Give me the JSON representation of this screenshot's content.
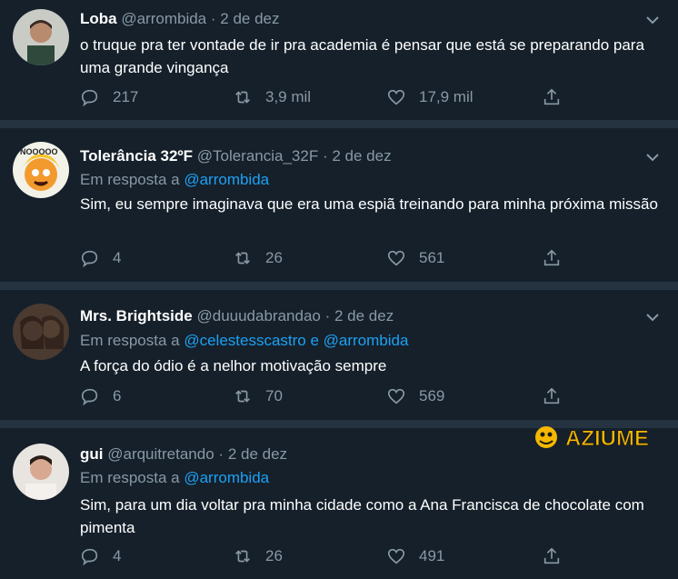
{
  "tweets": [
    {
      "name": "Loba",
      "handle": "@arrombida",
      "sep": "·",
      "date": "2 de dez",
      "reply_prefix": "",
      "reply_to": "",
      "text": "o truque pra ter vontade de ir pra academia é pensar que está se preparando para uma grande vingança",
      "replies": "217",
      "retweets": "3,9 mil",
      "likes": "17,9 mil"
    },
    {
      "name": "Tolerância 32ºF",
      "handle": "@Tolerancia_32F",
      "sep": "·",
      "date": "2 de dez",
      "reply_prefix": "Em resposta a ",
      "reply_to": "@arrombida",
      "text": "Sim, eu sempre imaginava que era uma espiã treinando para minha próxima missão",
      "replies": "4",
      "retweets": "26",
      "likes": "561"
    },
    {
      "name": "Mrs. Brightside",
      "handle": "@duuudabrandao",
      "sep": "·",
      "date": "2 de dez",
      "reply_prefix": "Em resposta a ",
      "reply_to": "@celestesscastro e @arrombida",
      "text": "A força do ódio é a nelhor motivação sempre",
      "replies": "6",
      "retweets": "70",
      "likes": "569"
    },
    {
      "name": "gui",
      "handle": "@arquitretando",
      "sep": "·",
      "date": "2 de dez",
      "reply_prefix": "Em resposta a ",
      "reply_to": "@arrombida",
      "text": "Sim, para um dia voltar pra minha cidade como a Ana Francisca de chocolate com pimenta",
      "replies": "4",
      "retweets": "26",
      "likes": "491"
    }
  ],
  "watermark": {
    "text": "AZIUME"
  },
  "colors": {
    "background": "#15202b",
    "divider": "#253341",
    "secondary": "#8899a6",
    "link": "#1da1f2",
    "watermark": "#f5b800"
  },
  "icons": [
    "reply-icon",
    "retweet-icon",
    "like-icon",
    "share-icon",
    "chevron-down-icon"
  ]
}
